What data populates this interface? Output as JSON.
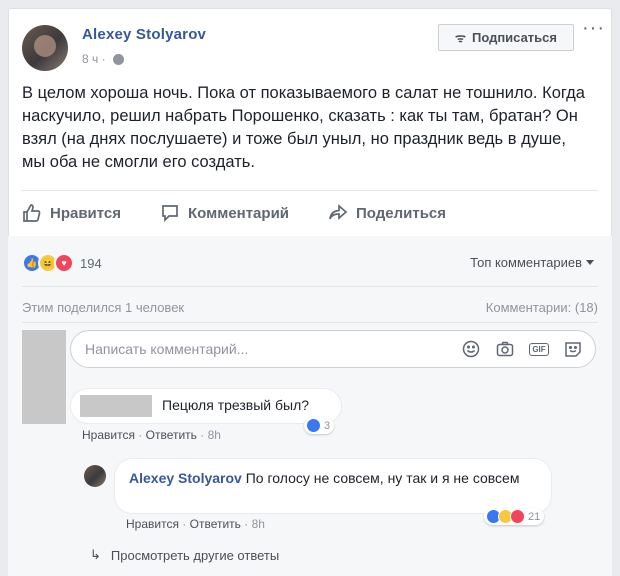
{
  "post": {
    "author": "Alexey Stolyarov",
    "time": "8 ч ·",
    "subscribe_label": "Подписаться",
    "text": "В целом хороша ночь. Пока от показываемого в салат не тошнило. Когда наскучило, решил набрать Порошенко, сказать : как ты там, братан? Он взял (на днях послушаете) и тоже был уныл, но праздник ведь в душе, мы оба не смогли его создать."
  },
  "actions": {
    "like": "Нравится",
    "comment": "Комментарий",
    "share": "Поделиться"
  },
  "summary": {
    "reaction_count": "194",
    "sort_label": "Топ комментариев",
    "shared_by": "Этим поделился 1 человек",
    "comments_count": "Комментарии: (18)"
  },
  "composer": {
    "placeholder": "Написать комментарий..."
  },
  "comments": [
    {
      "text": "Пецюля трезвый был?",
      "like": "Нравится",
      "reply": "Ответить",
      "time": "8h",
      "reactions": "3"
    },
    {
      "author": "Alexey Stolyarov",
      "text": "По голосу не совсем, ну так и я не совсем",
      "like": "Нравится",
      "reply": "Ответить",
      "time": "8h",
      "reactions": "21"
    }
  ],
  "view_more": "Просмотреть другие ответы",
  "colors": {
    "link": "#365899",
    "like": "#3a78f2",
    "haha": "#f7c940",
    "love": "#f0455b"
  }
}
